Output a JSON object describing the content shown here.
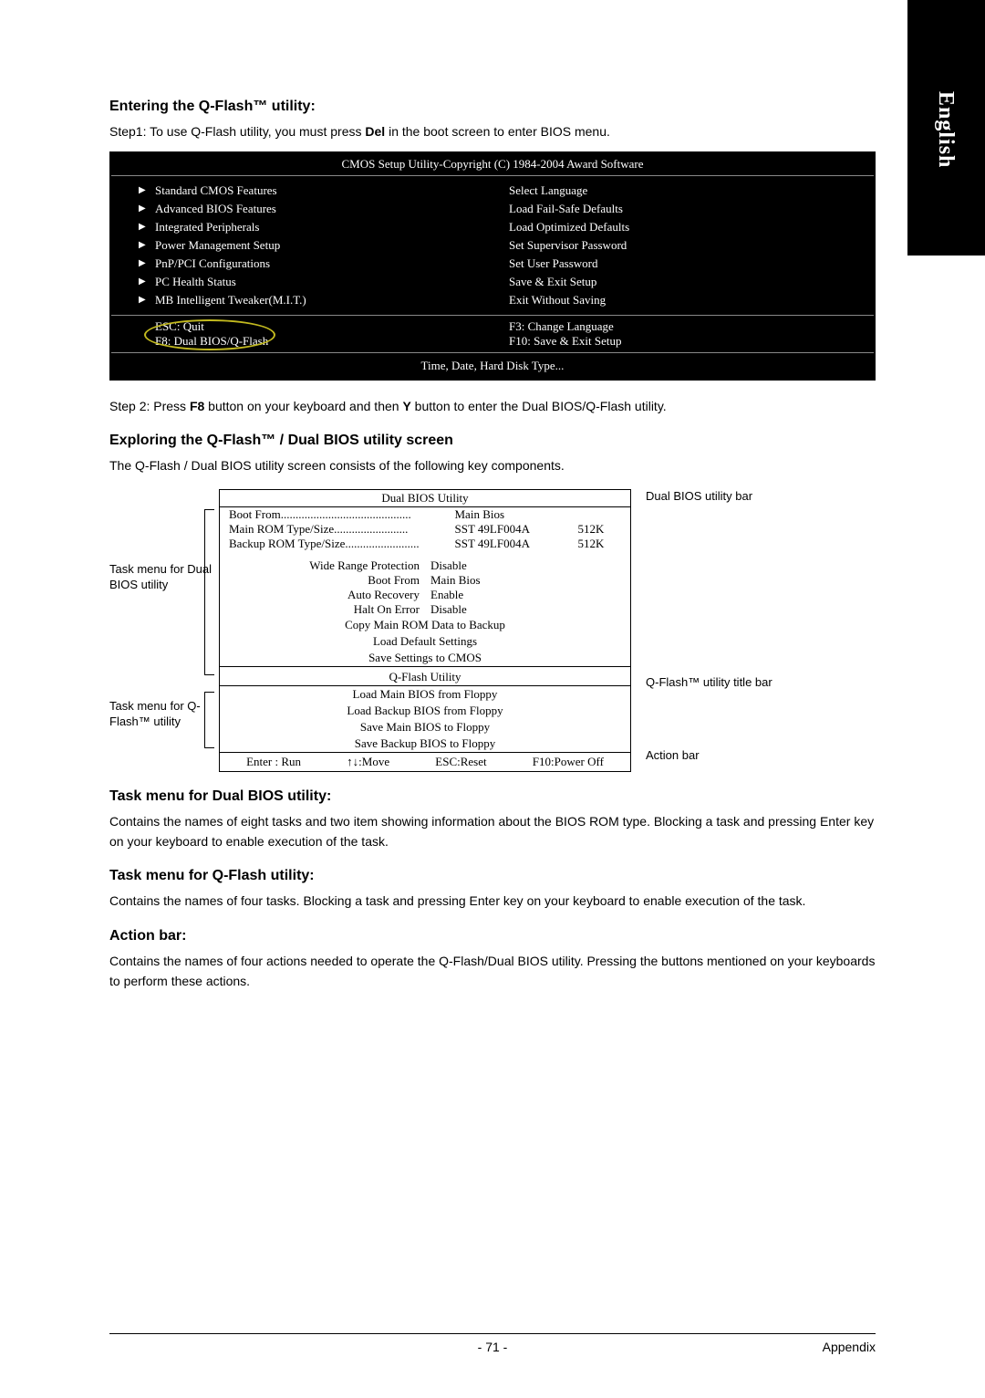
{
  "sideTab": "English",
  "s1_heading": "Entering the Q-Flash™ utility:",
  "s1_step1_full": "Step1: To use Q-Flash utility, you must press Del in the boot screen to enter BIOS menu.",
  "cmos": {
    "title": "CMOS Setup Utility-Copyright (C) 1984-2004 Award Software",
    "left": [
      "Standard CMOS Features",
      "Advanced BIOS Features",
      "Integrated Peripherals",
      "Power Management Setup",
      "PnP/PCI Configurations",
      "PC Health Status",
      "MB Intelligent Tweaker(M.I.T.)"
    ],
    "right": [
      "Select Language",
      "Load Fail-Safe Defaults",
      "Load Optimized Defaults",
      "Set Supervisor Password",
      "Set User Password",
      "Save & Exit Setup",
      "Exit Without Saving"
    ],
    "hints_left": [
      "ESC: Quit",
      "F8: Dual BIOS/Q-Flash"
    ],
    "hints_right": [
      "F3: Change Language",
      "F10: Save & Exit Setup"
    ],
    "help": "Time, Date, Hard Disk Type..."
  },
  "s1_step2_full": "Step 2: Press F8 button on your keyboard and then Y button to enter the Dual BIOS/Q-Flash utility.",
  "s2_heading": "Exploring the Q-Flash™ / Dual BIOS utility screen",
  "s2_intro": "The Q-Flash / Dual BIOS utility screen consists of the following key components.",
  "bios": {
    "title_dual": "Dual BIOS Utility",
    "boot_from_label": "Boot From",
    "boot_from_value": "Main Bios",
    "main_rom_label": "Main ROM Type/Size",
    "main_rom_val": "SST 49LF004A",
    "main_rom_size": "512K",
    "backup_rom_label": "Backup ROM Type/Size",
    "backup_rom_val": "SST 49LF004A",
    "backup_rom_size": "512K",
    "settings": [
      {
        "k": "Wide Range Protection",
        "v": "Disable"
      },
      {
        "k": "Boot From",
        "v": "Main Bios"
      },
      {
        "k": "Auto Recovery",
        "v": "Enable"
      },
      {
        "k": "Halt On Error",
        "v": "Disable"
      }
    ],
    "ops": [
      "Copy Main ROM Data to Backup",
      "Load Default Settings",
      "Save Settings to CMOS"
    ],
    "title_qflash": "Q-Flash Utility",
    "qflash_ops": [
      "Load Main BIOS from Floppy",
      "Load Backup BIOS from Floppy",
      "Save Main BIOS to Floppy",
      "Save Backup BIOS to Floppy"
    ],
    "actions": [
      "Enter : Run",
      "↑↓:Move",
      "ESC:Reset",
      "F10:Power Off"
    ]
  },
  "labels": {
    "left1": "Task menu for Dual BIOS utility",
    "left2": "Task menu for Q-Flash™ utility",
    "right1": "Dual BIOS utility bar",
    "right2": "Q-Flash™ utility title bar",
    "right3": "Action bar"
  },
  "s3_heading": "Task menu for Dual BIOS utility:",
  "s3_text": "Contains the names of eight tasks and two item showing information about the BIOS ROM type. Blocking a task and pressing Enter key on your keyboard to enable execution of the task.",
  "s4_heading": "Task menu for Q-Flash utility:",
  "s4_text": "Contains the names of four tasks. Blocking a task and pressing Enter key on your keyboard to enable execution of the task.",
  "s5_heading": "Action bar:",
  "s5_text": "Contains the names of four actions needed to operate the Q-Flash/Dual BIOS utility. Pressing the buttons mentioned on your keyboards to perform these actions.",
  "footer": {
    "page": "- 71 -",
    "section": "Appendix"
  }
}
